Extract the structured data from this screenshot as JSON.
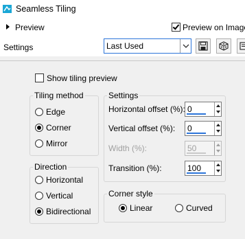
{
  "window": {
    "title": "Seamless Tiling",
    "icon": "app-icon",
    "accent": "#2b74d9"
  },
  "header": {
    "preview_label": "Preview",
    "preview_on_image_label": "Preview on Image",
    "preview_on_image_checked": true
  },
  "settings_bar": {
    "label": "Settings",
    "preset_value": "Last Used",
    "buttons": [
      "save-preset-icon",
      "randomize-icon",
      "reset-icon"
    ]
  },
  "show_tiling_preview": {
    "label": "Show tiling preview",
    "checked": false
  },
  "tiling_method": {
    "title": "Tiling method",
    "options": [
      "Edge",
      "Corner",
      "Mirror"
    ],
    "selected": "Corner"
  },
  "settings_group": {
    "title": "Settings",
    "horizontal_offset": {
      "label": "Horizontal offset (%):",
      "value": "0"
    },
    "vertical_offset": {
      "label": "Vertical offset (%):",
      "value": "0"
    },
    "width": {
      "label": "Width (%):",
      "value": "50",
      "disabled": true
    },
    "transition": {
      "label": "Transition (%):",
      "value": "100"
    }
  },
  "direction": {
    "title": "Direction",
    "options": [
      "Horizontal",
      "Vertical",
      "Bidirectional"
    ],
    "selected": "Bidirectional"
  },
  "corner_style": {
    "title": "Corner style",
    "options": [
      "Linear",
      "Curved"
    ],
    "selected": "Linear"
  }
}
